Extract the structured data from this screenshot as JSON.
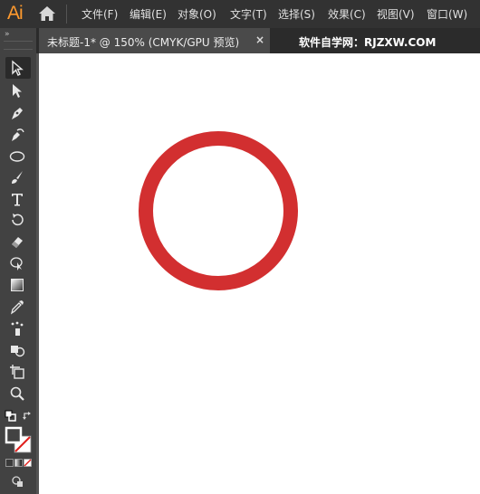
{
  "app": {
    "logo": "Ai"
  },
  "menubar": {
    "items": [
      "文件(F)",
      "编辑(E)",
      "对象(O)",
      "文字(T)",
      "选择(S)",
      "效果(C)",
      "视图(V)",
      "窗口(W)"
    ]
  },
  "document_tab": {
    "title": "未标题-1* @ 150% (CMYK/GPU 预览)",
    "close": "×"
  },
  "watermark": "软件自学网：RJZXW.COM",
  "toolbar": {
    "collapse": "»"
  },
  "tools": [
    {
      "name": "selection-tool-icon"
    },
    {
      "name": "direct-selection-tool-icon"
    },
    {
      "name": "pen-tool-icon"
    },
    {
      "name": "curvature-tool-icon"
    },
    {
      "name": "ellipse-tool-icon"
    },
    {
      "name": "paintbrush-tool-icon"
    },
    {
      "name": "type-tool-icon"
    },
    {
      "name": "rotate-tool-icon"
    },
    {
      "name": "eraser-tool-icon"
    },
    {
      "name": "puppet-warp-tool-icon"
    },
    {
      "name": "gradient-tool-icon"
    },
    {
      "name": "eyedropper-tool-icon"
    },
    {
      "name": "symbol-sprayer-tool-icon"
    },
    {
      "name": "shape-builder-tool-icon"
    },
    {
      "name": "artboard-tool-icon"
    },
    {
      "name": "zoom-tool-icon"
    }
  ],
  "colors": {
    "circle_stroke": "#d22f30",
    "canvas": "#ffffff",
    "menubar": "#323232",
    "toolbar": "#424242"
  }
}
